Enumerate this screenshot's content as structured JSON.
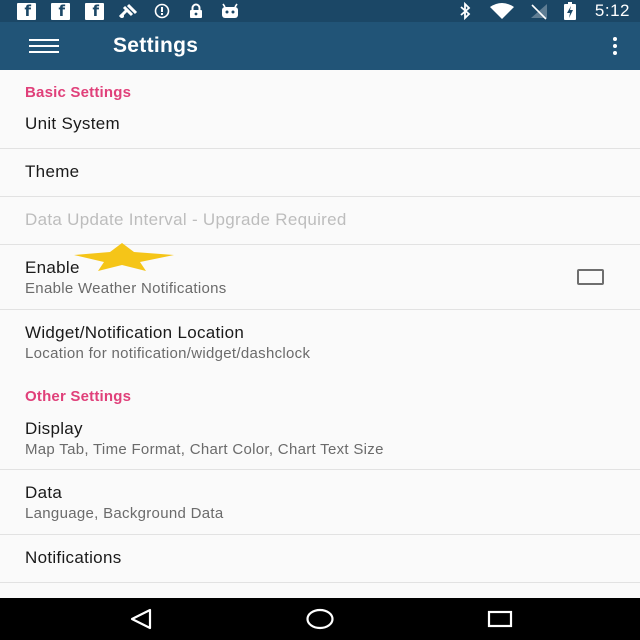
{
  "status_bar": {
    "time": "5:12",
    "left_icons": [
      "facebook-icon",
      "facebook-icon",
      "facebook-icon",
      "satellite-icon",
      "data-saver-icon",
      "lock-icon",
      "android-icon"
    ],
    "right_icons": [
      "bluetooth-icon",
      "wifi-icon",
      "no-signal-icon",
      "battery-charging-icon"
    ]
  },
  "app_bar": {
    "title": "Settings",
    "menu_icon": "hamburger-menu-icon",
    "overflow_icon": "more-vert-icon",
    "color": "#215477"
  },
  "sections": {
    "basic_header": "Basic Settings",
    "other_header": "Other Settings"
  },
  "prefs": {
    "unit_system": {
      "title": "Unit System"
    },
    "theme": {
      "title": "Theme"
    },
    "data_update": {
      "title": "Data Update Interval - Upgrade Required",
      "enabled": false
    },
    "enable": {
      "title": "Enable",
      "summary": "Enable Weather Notifications",
      "checked": false
    },
    "widget_location": {
      "title": "Widget/Notification Location",
      "summary": "Location for notification/widget/dashclock"
    },
    "display": {
      "title": "Display",
      "summary": "Map Tab, Time Format, Chart Color, Chart Text Size"
    },
    "data": {
      "title": "Data",
      "summary": "Language, Background Data"
    },
    "notifications": {
      "title": "Notifications"
    }
  },
  "colors": {
    "section_header": "#e0407a",
    "status_bar": "#1b4766",
    "star": "#f5c518"
  },
  "nav_bar": {
    "back_icon": "back-triangle-icon",
    "home_icon": "home-circle-icon",
    "recents_icon": "recents-square-icon"
  }
}
